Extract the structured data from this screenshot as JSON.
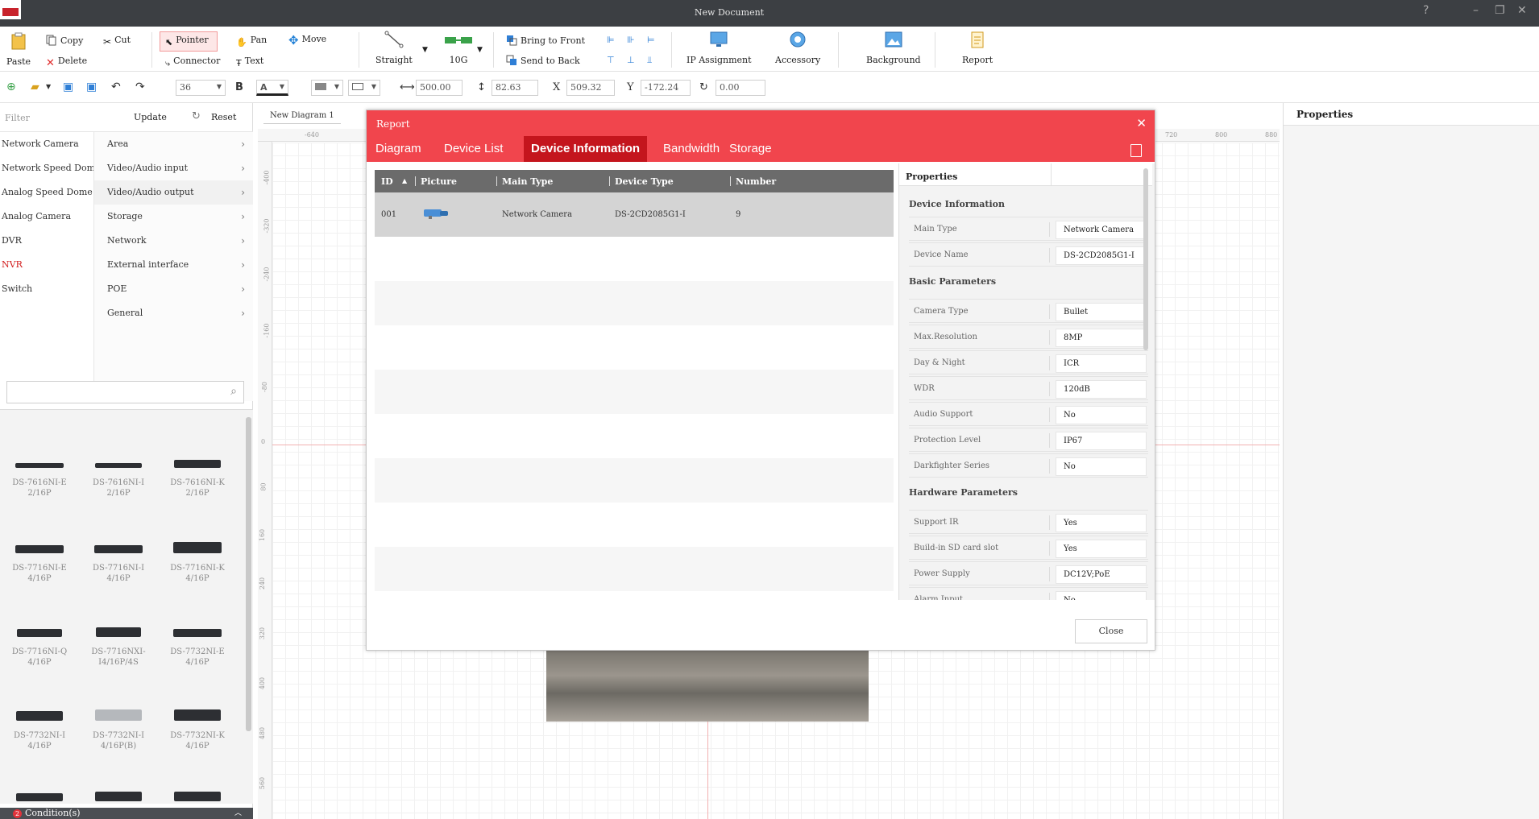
{
  "window": {
    "title": "New Document"
  },
  "toolbar": {
    "paste": "Paste",
    "copy": "Copy",
    "cut": "Cut",
    "delete": "Delete",
    "pointer": "Pointer",
    "pan": "Pan",
    "move": "Move",
    "connector": "Connector",
    "text": "Text",
    "straight": "Straight",
    "link_speed": "10G",
    "bring_to_front": "Bring to Front",
    "send_to_back": "Send to Back",
    "ip_assignment": "IP Assignment",
    "accessory": "Accessory",
    "background": "Background",
    "report": "Report"
  },
  "format_bar": {
    "font_size": "36",
    "bold": "B",
    "font_color": "A",
    "width_value": "500.00",
    "height_value": "82.63",
    "x_label": "X",
    "x_value": "509.32",
    "y_label": "Y",
    "y_value": "-172.24",
    "rotation_value": "0.00"
  },
  "left_panel": {
    "filter_label": "Filter",
    "update_label": "Update",
    "reset_label": "Reset",
    "categories": [
      "Network Camera",
      "Network Speed Dome",
      "Analog Speed Dome",
      "Analog Camera",
      "DVR",
      "NVR",
      "Switch"
    ],
    "subcategories": [
      "Area",
      "Video/Audio input",
      "Video/Audio output",
      "Storage",
      "Network",
      "External interface",
      "POE",
      "General"
    ],
    "devices": [
      {
        "line1": "DS-7616NI-E",
        "line2": "2/16P"
      },
      {
        "line1": "DS-7616NI-I",
        "line2": "2/16P"
      },
      {
        "line1": "DS-7616NI-K",
        "line2": "2/16P"
      },
      {
        "line1": "DS-7716NI-E",
        "line2": "4/16P"
      },
      {
        "line1": "DS-7716NI-I",
        "line2": "4/16P"
      },
      {
        "line1": "DS-7716NI-K",
        "line2": "4/16P"
      },
      {
        "line1": "DS-7716NI-Q",
        "line2": "4/16P"
      },
      {
        "line1": "DS-7716NXI-",
        "line2": "I4/16P/4S"
      },
      {
        "line1": "DS-7732NI-E",
        "line2": "4/16P"
      },
      {
        "line1": "DS-7732NI-I",
        "line2": "4/16P"
      },
      {
        "line1": "DS-7732NI-I",
        "line2": "4/16P(B)"
      },
      {
        "line1": "DS-7732NI-K",
        "line2": "4/16P"
      },
      {
        "line1": "",
        "line2": ""
      },
      {
        "line1": "",
        "line2": ""
      },
      {
        "line1": "",
        "line2": ""
      }
    ],
    "condition_label": "Condition(s)",
    "condition_count": "2"
  },
  "canvas": {
    "tab_label": "New Diagram 1",
    "h_ticks": [
      "-640",
      "720",
      "800",
      "880"
    ],
    "v_ticks": [
      "-400",
      "-320",
      "-240",
      "-160",
      "-80",
      "0",
      "80",
      "160",
      "240",
      "320",
      "400",
      "480",
      "560"
    ]
  },
  "properties_panel": {
    "title": "Properties"
  },
  "report": {
    "title": "Report",
    "tabs": [
      "Diagram",
      "Device List",
      "Device Information",
      "Bandwidth",
      "Storage"
    ],
    "active_tab": "Device Information",
    "columns": [
      "ID",
      "Picture",
      "Main Type",
      "Device Type",
      "Number"
    ],
    "rows": [
      {
        "id": "001",
        "main_type": "Network Camera",
        "device_type": "DS-2CD2085G1-I",
        "number": "9"
      }
    ],
    "properties_title": "Properties",
    "device_information": {
      "title": "Device Information",
      "fields": [
        {
          "key": "Main Type",
          "value": "Network Camera"
        },
        {
          "key": "Device Name",
          "value": "DS-2CD2085G1-I"
        }
      ]
    },
    "basic_parameters": {
      "title": "Basic Parameters",
      "fields": [
        {
          "key": "Camera Type",
          "value": "Bullet"
        },
        {
          "key": "Max.Resolution",
          "value": "8MP"
        },
        {
          "key": "Day & Night",
          "value": "ICR"
        },
        {
          "key": "WDR",
          "value": "120dB"
        },
        {
          "key": "Audio Support",
          "value": "No"
        },
        {
          "key": "Protection Level",
          "value": "IP67"
        },
        {
          "key": "Darkfighter Series",
          "value": "No"
        }
      ]
    },
    "hardware_parameters": {
      "title": "Hardware Parameters",
      "fields": [
        {
          "key": "Support IR",
          "value": "Yes"
        },
        {
          "key": "Build-in SD card slot",
          "value": "Yes"
        },
        {
          "key": "Power Supply",
          "value": "DC12V;PoE"
        },
        {
          "key": "Alarm Input",
          "value": "No"
        }
      ]
    },
    "close_label": "Close"
  },
  "colors": {
    "accent": "#f1454d",
    "active_tab": "#c4151d",
    "titlebar": "#3c3f43",
    "table_header": "#6b6b6b"
  }
}
